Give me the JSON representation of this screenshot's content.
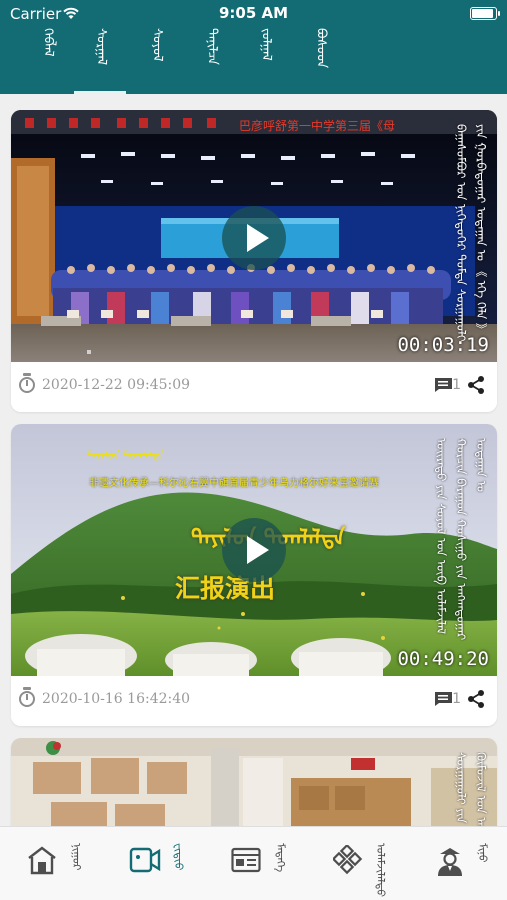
{
  "status_bar": {
    "carrier": "Carrier",
    "time": "9:05 AM",
    "battery_level": 0.95
  },
  "tabs": [
    {
      "label": "ᠬᠡᠪᠯᠡᠯ",
      "selected": false
    },
    {
      "label": "ᠰᠤᠷᠭᠠᠯ",
      "selected": true
    },
    {
      "label": "ᠰᠣᠶᠣᠯ",
      "selected": false
    },
    {
      "label": "ᠲᠠᠨᠢᠯᠴᠠ",
      "selected": false
    },
    {
      "label": "ᠵᠤᠯᠭᠠᠯ",
      "selected": false
    },
    {
      "label": "ᠪᠤᠰᠤᠳ",
      "selected": false
    }
  ],
  "videos": [
    {
      "title": "ᠪᠠᠭᠠᠰᠤᠮᠪᠤᠷ ᠤᠨ ᠨᠢᠭᠡᠳᠦᠭᠡᠷ ᠳᠤᠮᠳᠠ ᠰᠤᠷᠭᠠᠭᠤᠯᠢ ᠶᠢᠨ ᠭᠤᠷᠪᠠᠳᠤᠭᠠᠷ ᠤᠳᠠᠭᠠᠨ ᠤ 《 ᠡᠬᠡ ᠬᠡᠯᠡ 》",
      "banner_text": "巴彦呼舒第一中学第三届《母",
      "duration": "00:03:19",
      "date": "2020-12-22 09:45:09",
      "comments": "1"
    },
    {
      "title": "ᠣᠢᠷᠠᠳᠤ ᠶᠢᠨ ᠰᠣᠶᠣᠯ ᠤᠨ ᠥᠪ ᠤᠯᠠᠮᠵᠢᠯᠠᠯ ᠬᠣᠷᠴᠢᠨ ᠪᠠᠷᠠᠭᠤᠨ ᠬᠣᠰᠢᠭᠤ ᠶᠢᠨ ᠠᠩᠬᠠᠳᠤᠭᠠᠷ ᠤᠳᠠᠭᠠᠨ ᠤ",
      "banner_text": "非遗文化传承—科尔沁右翼中旗首届青少年乌力格尔好来宝邀请赛",
      "thumb_heading": "ᠲᠠᠶᠢᠯᠤᠨ ᠲᠣᠭᠯᠠᠯᠲᠠ",
      "thumb_subheading": "汇报演出",
      "duration": "00:49:20",
      "date": "2020-10-16 16:42:40",
      "comments": "1"
    },
    {
      "title": "ᠰᠤᠷᠭᠠᠭᠤᠯᠢ ᠶᠢᠨ ᠬᠦᠮᠦᠵᠢᠯ ᠤᠨ ᠠᠵᠢᠯ"
    }
  ],
  "bottom_nav": [
    {
      "label": "ᠨᠢᠭᠤᠷ",
      "icon": "home-icon"
    },
    {
      "label": "ᠸᠢᠳᠢᠤ",
      "icon": "video-icon",
      "active": true
    },
    {
      "label": "ᠮᠡᠳᠡᠭᠡ",
      "icon": "news-icon"
    },
    {
      "label": "ᠤᠯᠠᠮᠵᠢᠯᠠᠯᠲᠤ",
      "icon": "knot-icon"
    },
    {
      "label": "ᠮᠢᠨᠦ",
      "icon": "profile-icon"
    }
  ],
  "colors": {
    "primary": "#136b73",
    "background": "#efefef",
    "meta_text": "#9a9a9a"
  }
}
